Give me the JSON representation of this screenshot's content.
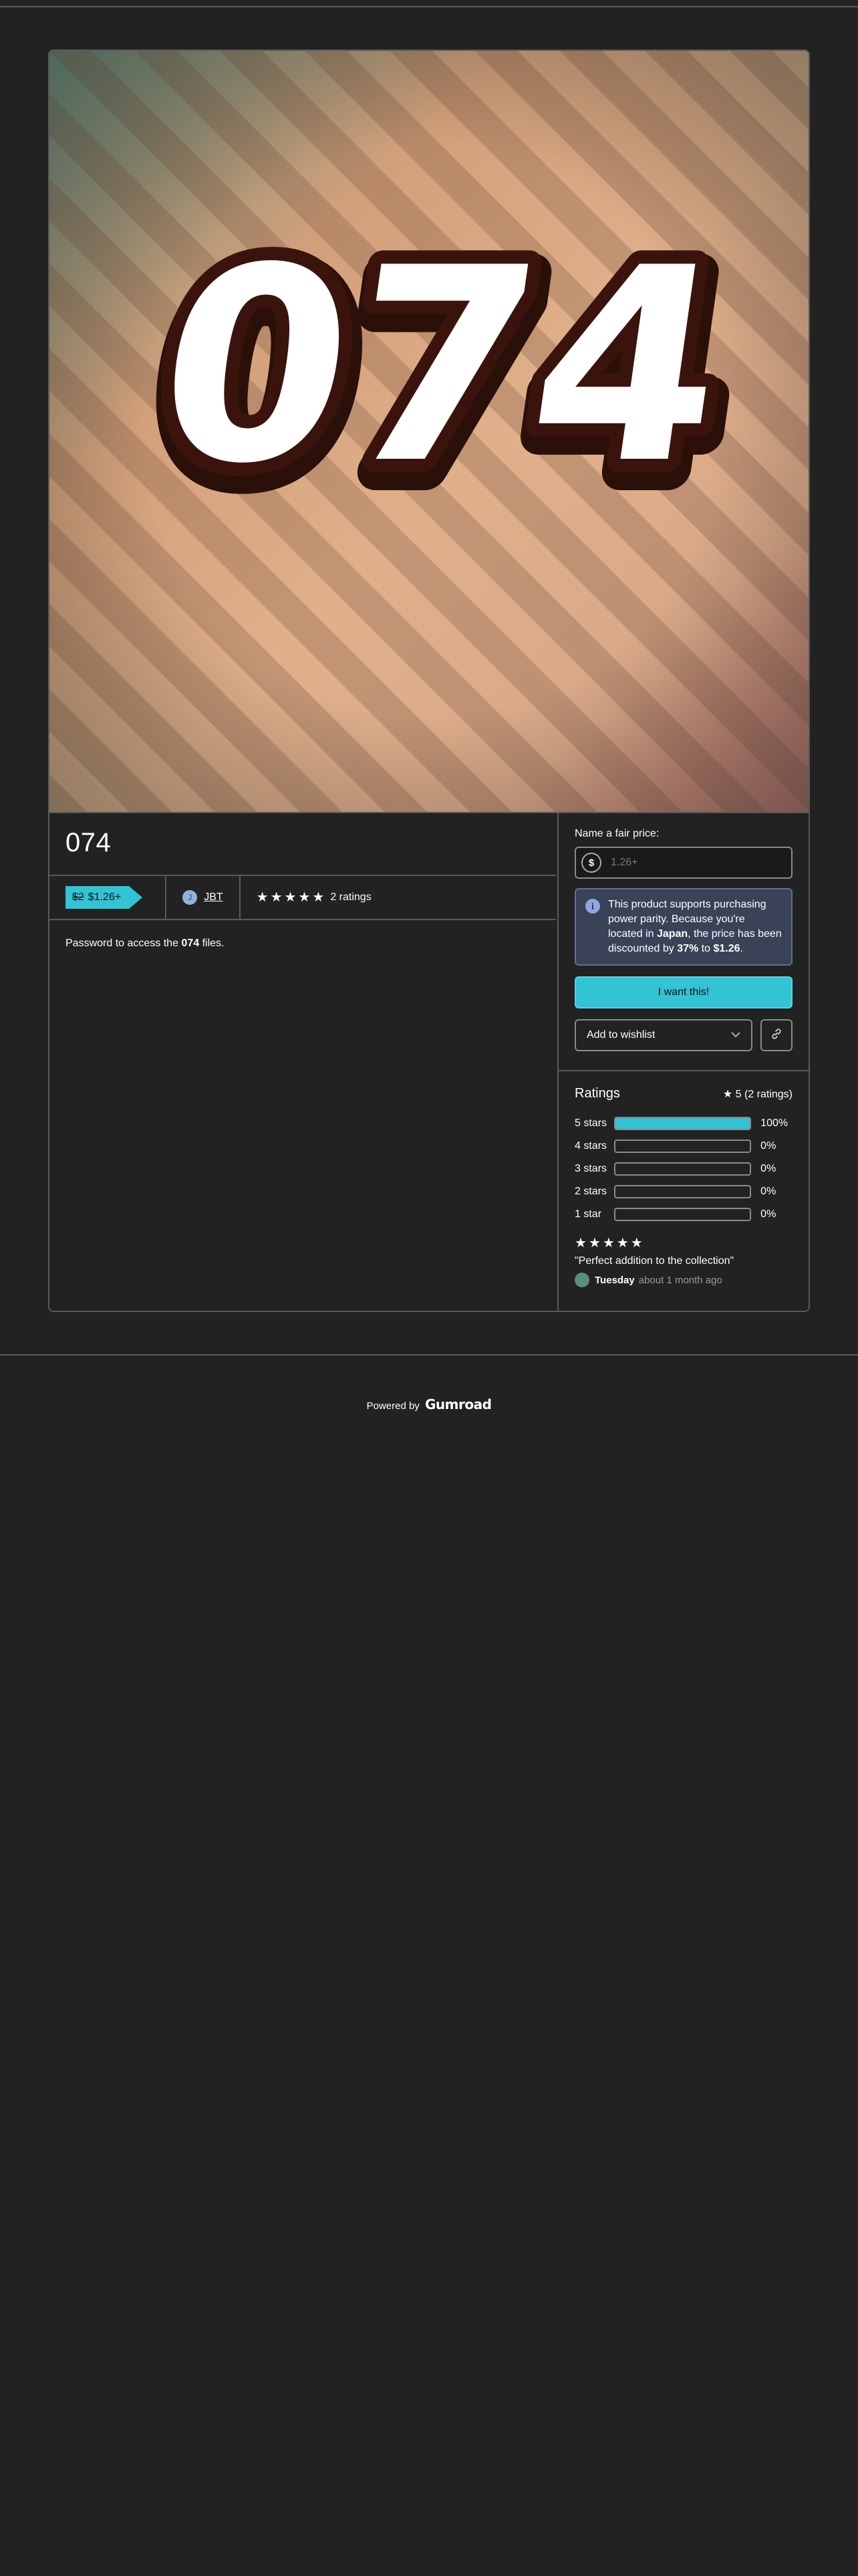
{
  "product": {
    "title": "074",
    "cover_text": "074",
    "price_old": "$2",
    "price_new": "$1.26+",
    "creator": "JBT",
    "creator_initial": "J",
    "ratings_label": "2 ratings",
    "description_prefix": "Password to access the ",
    "description_bold": "074",
    "description_suffix": " files."
  },
  "purchase": {
    "fair_price_label": "Name a fair price:",
    "currency_symbol": "$",
    "price_placeholder": "1.26+",
    "info_icon": "info-icon",
    "info_part1": "This product supports purchasing power parity. Because you're located in ",
    "info_country": "Japan",
    "info_part2": ", the price has been discounted by ",
    "info_discount": "37%",
    "info_part3": " to ",
    "info_price": "$1.26",
    "info_part4": ".",
    "buy_label": "I want this!",
    "wishlist_label": "Add to wishlist",
    "chevron_icon": "chevron-down-icon",
    "share_icon": "link-icon"
  },
  "ratings": {
    "title": "Ratings",
    "summary": "5 (2 ratings)",
    "breakdown": [
      {
        "label": "5 stars",
        "percent": "100%",
        "fraction": 1.0
      },
      {
        "label": "4 stars",
        "percent": "0%",
        "fraction": 0
      },
      {
        "label": "3 stars",
        "percent": "0%",
        "fraction": 0
      },
      {
        "label": "2 stars",
        "percent": "0%",
        "fraction": 0
      },
      {
        "label": "1 star",
        "percent": "0%",
        "fraction": 0
      }
    ],
    "review": {
      "stars": 5,
      "text": "\"Perfect addition to the collection\"",
      "author": "Tuesday",
      "time": "about 1 month ago"
    }
  },
  "footer": {
    "powered_by": "Powered by",
    "brand": "Gumroad"
  },
  "colors": {
    "accent": "#32c3d4",
    "background": "#222222",
    "info_bg": "#3a4257"
  }
}
